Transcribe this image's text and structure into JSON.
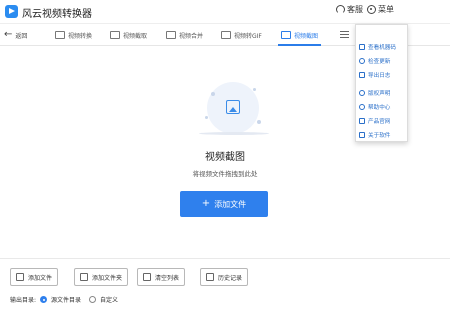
{
  "app": {
    "title": "风云视频转换器",
    "service_label": "客服",
    "menu_label": "菜单"
  },
  "toolbar": {
    "back_label": "返回",
    "tabs": [
      {
        "label": "视频转换",
        "icon": "video-convert-icon"
      },
      {
        "label": "视频截取",
        "icon": "video-cut-icon"
      },
      {
        "label": "视频合并",
        "icon": "video-merge-icon"
      },
      {
        "label": "视频转GIF",
        "icon": "gif-icon"
      },
      {
        "label": "视频截图",
        "icon": "screenshot-icon",
        "active": true
      }
    ]
  },
  "main": {
    "title": "视频截图",
    "subtitle": "将视频文件拖拽到此处",
    "add_file_button": "添加文件"
  },
  "bottom": {
    "buttons": [
      "添加文件",
      "添加文件夹",
      "清空列表",
      "历史记录"
    ],
    "output_label": "输出目录:",
    "options": [
      {
        "label": "源文件目录",
        "checked": true
      },
      {
        "label": "自定义",
        "checked": false
      }
    ]
  },
  "menu": {
    "items": [
      "查看机器码",
      "检查更新",
      "导出日志",
      "版权声明",
      "帮助中心",
      "产品官网",
      "关于软件"
    ]
  },
  "colors": {
    "accent": "#2f80ed",
    "menu_text": "#2a6fc9"
  }
}
